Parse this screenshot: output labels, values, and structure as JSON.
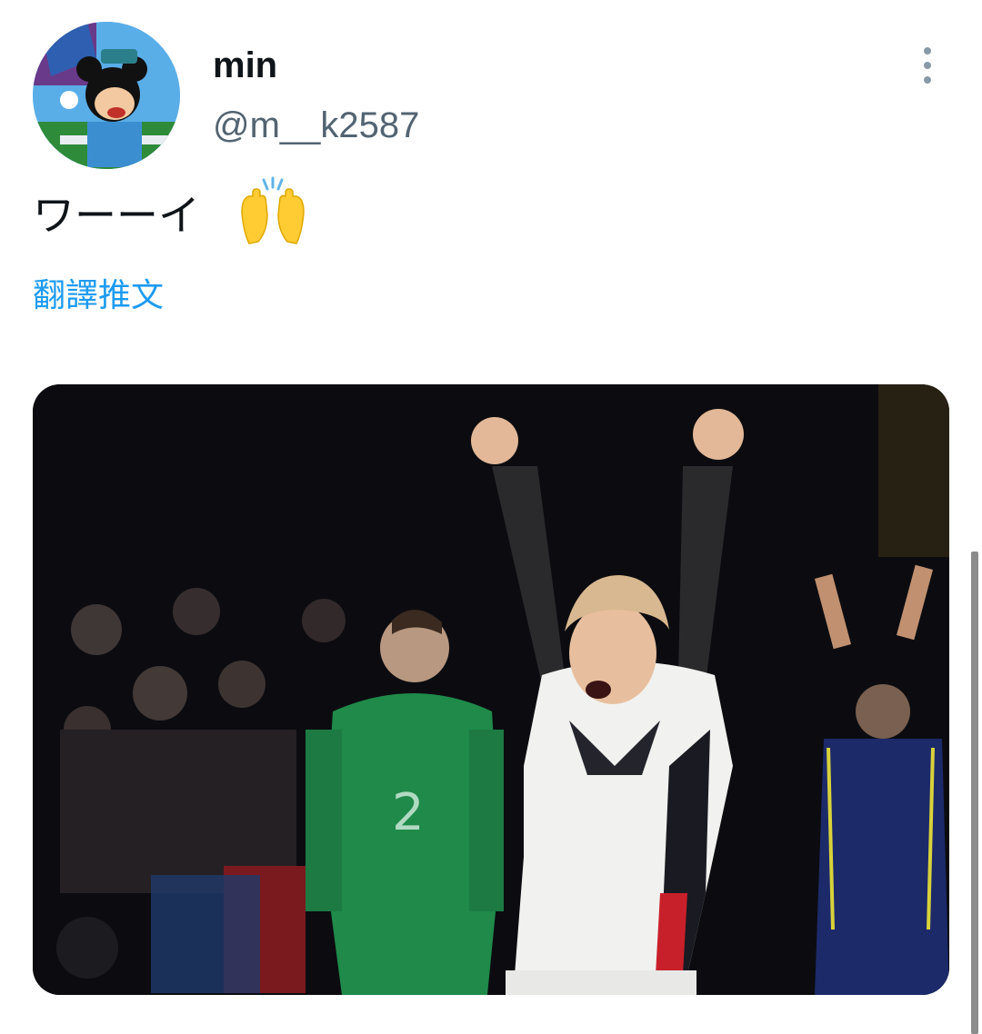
{
  "tweet": {
    "display_name": "min",
    "handle": "@m__k2587",
    "text": "ワーーイ",
    "emoji": "raising-hands",
    "translate_label": "翻譯推文"
  },
  "icons": {
    "more": "more-vertical-icon",
    "emoji": "raising-hands-icon"
  },
  "colors": {
    "link": "#1d9bf0",
    "handle": "#536471",
    "text": "#0f1419"
  }
}
